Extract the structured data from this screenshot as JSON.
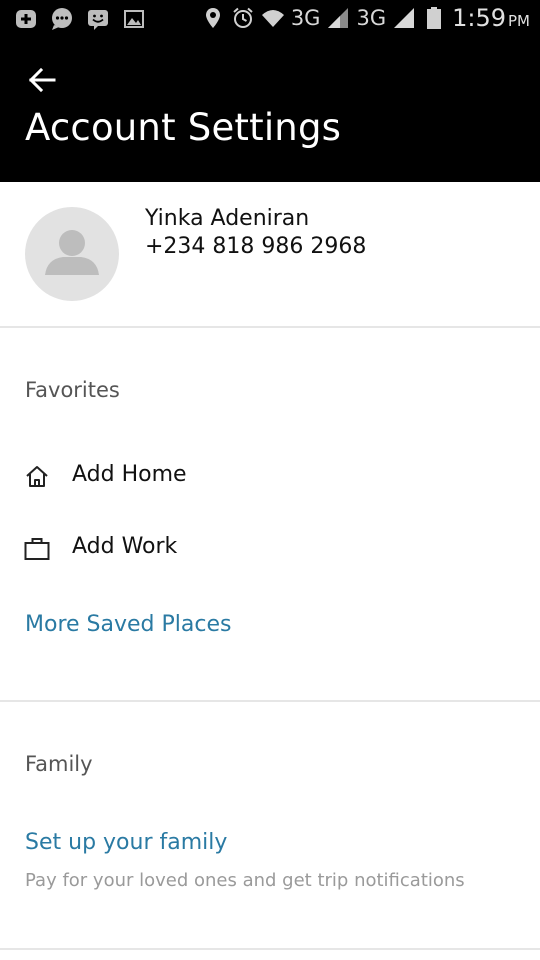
{
  "status_bar": {
    "network_1": "3G",
    "network_2": "3G",
    "time": "1:59",
    "ampm": "PM"
  },
  "header": {
    "title": "Account Settings"
  },
  "profile": {
    "name": "Yinka Adeniran",
    "phone": "+234 818 986 2968"
  },
  "favorites": {
    "title": "Favorites",
    "add_home": "Add Home",
    "add_work": "Add Work",
    "more_saved_places": "More Saved Places"
  },
  "family": {
    "title": "Family",
    "setup_link": "Set up your family",
    "description": "Pay for your loved ones and get trip notifications"
  },
  "colors": {
    "header_bg": "#000000",
    "link": "#2a7aa3"
  }
}
